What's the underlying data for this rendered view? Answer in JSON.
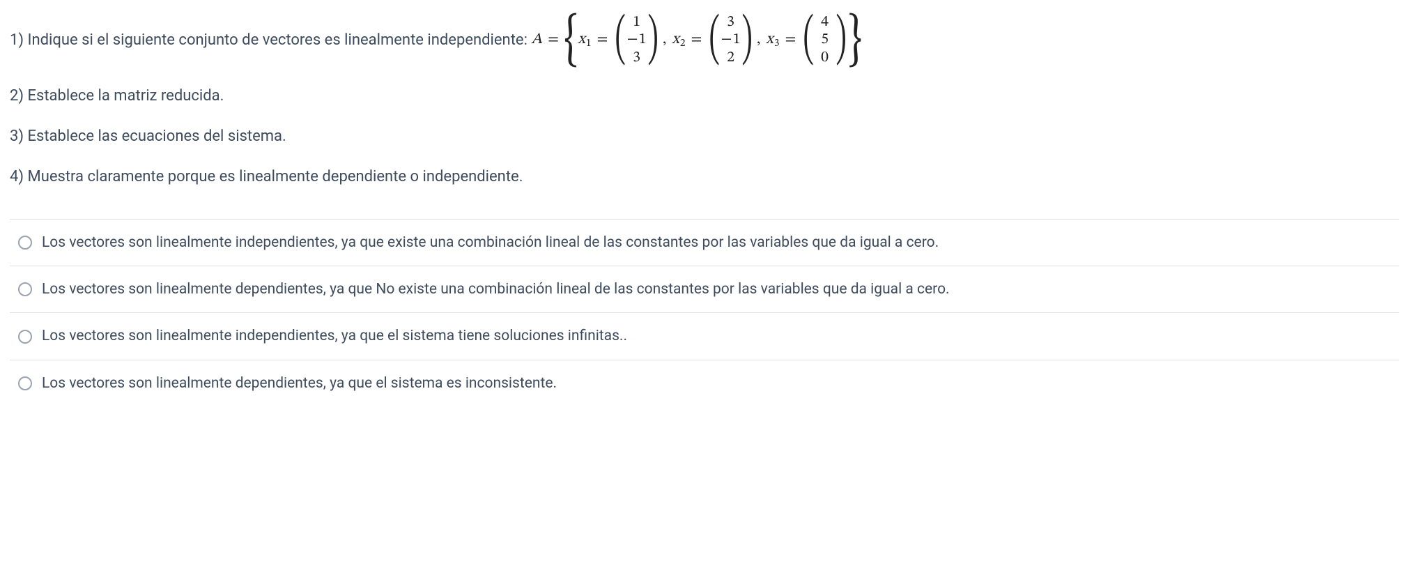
{
  "question": {
    "line1_prefix": "1) Indique si el siguiente conjunto de vectores es linealmente independiente: ",
    "A_sym": "A",
    "eq_sym": "=",
    "x_sym": "x",
    "sub1": "1",
    "sub2": "2",
    "sub3": "3",
    "comma": ",",
    "lbrace": "{",
    "rbrace": "}",
    "lparen": "(",
    "rparen": ")",
    "vec1": {
      "r1": "1",
      "r2": "− 1",
      "r3": "3"
    },
    "vec2": {
      "r1": "3",
      "r2": "− 1",
      "r3": "2"
    },
    "vec3": {
      "r1": "4",
      "r2": "5",
      "r3": "0"
    },
    "line2": "2) Establece la matriz reducida.",
    "line3": "3) Establece las ecuaciones del sistema.",
    "line4": "4) Muestra claramente porque es linealmente dependiente o independiente."
  },
  "options": [
    {
      "label": "Los vectores son linealmente independientes, ya que existe una combinación lineal de las constantes por las variables que da igual a cero."
    },
    {
      "label": "Los vectores son linealmente dependientes, ya que No existe una combinación lineal de las constantes por las variables que da igual a cero."
    },
    {
      "label": "Los vectores son linealmente independientes, ya que el sistema tiene soluciones infinitas.."
    },
    {
      "label": "Los vectores son linealmente dependientes, ya que el sistema es inconsistente."
    }
  ]
}
